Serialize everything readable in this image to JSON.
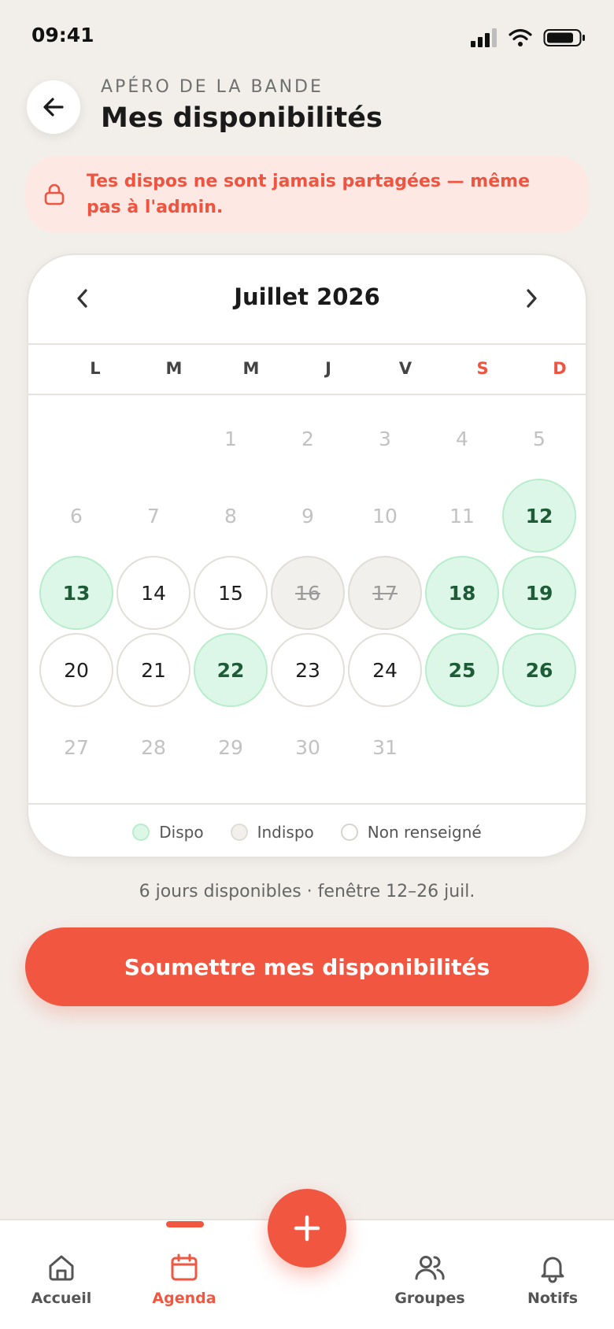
{
  "status_bar": {
    "time": "09:41"
  },
  "header": {
    "group_name": "APÉRO DE LA BANDE",
    "title": "Mes disponibilités"
  },
  "privacy_note": {
    "text": "Tes dispos ne sont jamais partagées — même pas à l'admin."
  },
  "calendar": {
    "month": "Juillet 2026",
    "weekdays": [
      "L",
      "M",
      "M",
      "J",
      "V",
      "S",
      "D"
    ],
    "days": {
      "d1": "1",
      "d2": "2",
      "d3": "3",
      "d4": "4",
      "d5": "5",
      "d6": "6",
      "d7": "7",
      "d8": "8",
      "d9": "9",
      "d10": "10",
      "d11": "11",
      "d12": "12",
      "d13": "13",
      "d14": "14",
      "d15": "15",
      "d16": "16",
      "d17": "17",
      "d18": "18",
      "d19": "19",
      "d20": "20",
      "d21": "21",
      "d22": "22",
      "d23": "23",
      "d24": "24",
      "d25": "25",
      "d26": "26",
      "d27": "27",
      "d28": "28",
      "d29": "29",
      "d30": "30",
      "d31": "31"
    },
    "states": {
      "available": [
        "12",
        "13",
        "18",
        "19",
        "22",
        "25",
        "26"
      ],
      "unavailable": [
        "16",
        "17"
      ],
      "unanswered": [
        "14",
        "15",
        "20",
        "21",
        "23",
        "24"
      ]
    },
    "legend": {
      "dispo": "Dispo",
      "indispo": "Indispo",
      "non_renseigne": "Non renseigné"
    }
  },
  "summary": "6 jours disponibles · fenêtre 12–26 juil.",
  "submit_label": "Soumettre mes disponibilités",
  "tabs": {
    "home": "Accueil",
    "agenda": "Agenda",
    "groups": "Groupes",
    "notifs": "Notifs",
    "active": "Agenda"
  },
  "colors": {
    "accent": "#F15640",
    "available_bg": "#DCF7E7",
    "available_text": "#1E5B37",
    "background": "#F2EFEB"
  }
}
